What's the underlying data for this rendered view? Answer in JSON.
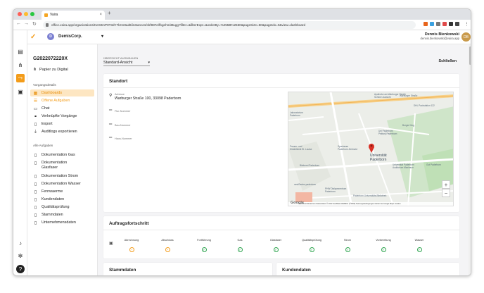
{
  "browser": {
    "tab_title": "Vaira",
    "url": "office.vaira.app/organizations/KeS0mP0T3dY7kCn8ad6/instances/cbf987e/fbgehmi8tugg?filter=&filterExpr=&orderBy=%255B%2550&pageSize=50&pageIdx=0&view=dashboard"
  },
  "header": {
    "org_initial": "D",
    "org_name": "DemisCorp.",
    "user_name": "Dennis Bienkowski",
    "user_email": "dennis.bienkowski@vaira.app",
    "user_initials": "DB"
  },
  "sidebar": {
    "title": "G2022072220X",
    "paper_label": "Papier zu Digital",
    "section1": "Vorgangsdetails",
    "details": [
      {
        "label": "Dashboards",
        "icon": "grid-icon"
      },
      {
        "label": "Offene Aufgaben",
        "icon": "checklist-icon"
      },
      {
        "label": "Chat",
        "icon": "chat-icon"
      },
      {
        "label": "Verknüpfte Vorgänge",
        "icon": "link-icon"
      },
      {
        "label": "Export",
        "icon": "export-icon"
      },
      {
        "label": "Auditlogs exportieren",
        "icon": "download-icon"
      }
    ],
    "section2": "Alle Aufgaben",
    "tasks": [
      "Dokumentation Gas",
      "Dokumentation Glasfaser",
      "Dokumentation Strom",
      "Dokumentation Wasser",
      "Fernwaerme",
      "Kundendaten",
      "Qualitätsprüfung",
      "Stammdaten",
      "Unternehmensdaten"
    ]
  },
  "main": {
    "view_label": "ÜBERSICHT AUSWÄHLEN",
    "view_value": "Standard-Ansicht",
    "close_label": "Schließen",
    "location": {
      "title": "Standort",
      "address_label": "Adresse",
      "address_value": "Warburger Straße 100, 33098 Paderborn",
      "flur_label": "Flur-Nummer",
      "bau_label": "Bau-Nummer",
      "haus_label": "Haus-Nummer"
    },
    "map": {
      "labels": [
        "Apotheke am Warburger Straße",
        "Schöne Aussicht",
        "Warburger Straße",
        "DHL Packstation 122",
        "Laboratorium",
        "Paderborn",
        "Uni Paderborn",
        "Pektorij Paderborn",
        "Burger King",
        "Frauen- und Kinderklinik St. Louise",
        "Sparkasse Paderborn-Detmold",
        "Universität Paderborn",
        "Universität Paderborn Auditorium Maximum",
        "Bäckerei Paderborn",
        "Gut Paderborn",
        "nestGarten paderborn",
        "PHW Dialysezentrum Paderborn",
        "Paderborn Universitäts-Bibliothek"
      ],
      "footer": "Tastenkombinationen   Kartendaten © 2022 GeoBasis-DE/BKG (©2009)   Nutzungsbedingungen   Fehler bei Google Maps melden",
      "google": "Google",
      "zoom_in": "+",
      "zoom_out": "−"
    },
    "progress": {
      "title": "Auftragsfortschritt",
      "steps": [
        {
          "label": "Abrechnung",
          "status": "pending"
        },
        {
          "label": "Abschluss",
          "status": "pending"
        },
        {
          "label": "Fortführung",
          "status": "done"
        },
        {
          "label": "Gas",
          "status": "done"
        },
        {
          "label": "Glasfaser",
          "status": "done"
        },
        {
          "label": "Qualitätsprüfung",
          "status": "done"
        },
        {
          "label": "Strom",
          "status": "done"
        },
        {
          "label": "Vorbereitung",
          "status": "done"
        },
        {
          "label": "Wasser",
          "status": "done"
        }
      ]
    },
    "stammdaten_title": "Stammdaten",
    "kundendaten_title": "Kundendaten"
  },
  "colors": {
    "accent": "#f39c1a",
    "done": "#2ea44f"
  }
}
